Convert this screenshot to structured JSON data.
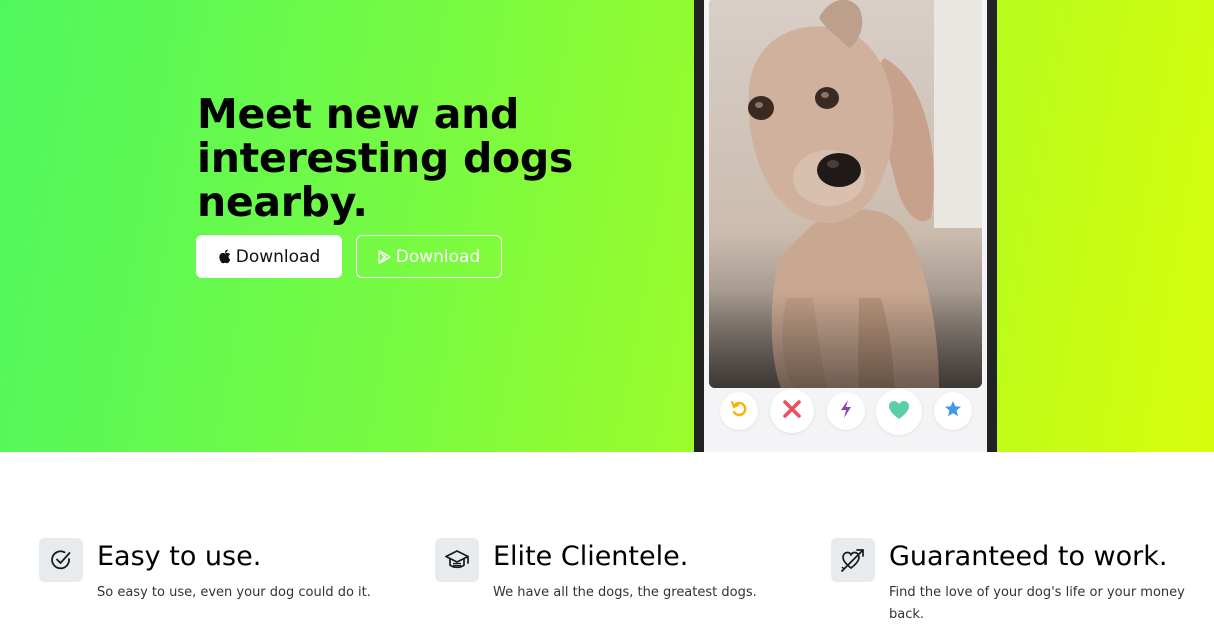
{
  "hero": {
    "title": "Meet new and interesting dogs nearby.",
    "apple_button_label": "Download",
    "play_button_label": "Download",
    "apple_icon": "apple-icon",
    "play_icon": "google-play-icon"
  },
  "phone": {
    "photo": "dog-photo",
    "actions": [
      {
        "name": "rewind-icon",
        "color": "#f5b700"
      },
      {
        "name": "nope-icon",
        "color": "#ec4f5f"
      },
      {
        "name": "boost-icon",
        "color": "#8e44ad"
      },
      {
        "name": "like-icon",
        "color": "#5dcfa6"
      },
      {
        "name": "super-like-icon",
        "color": "#3d9ae8"
      }
    ]
  },
  "features": [
    {
      "icon": "check-circle-icon",
      "title": "Easy to use.",
      "description": "So easy to use, even your dog could do it."
    },
    {
      "icon": "graduation-cap-icon",
      "title": "Elite Clientele.",
      "description": "We have all the dogs, the greatest dogs."
    },
    {
      "icon": "heart-arrow-icon",
      "title": "Guaranteed to work.",
      "description": "Find the love of your dog's life or your money back."
    }
  ]
}
